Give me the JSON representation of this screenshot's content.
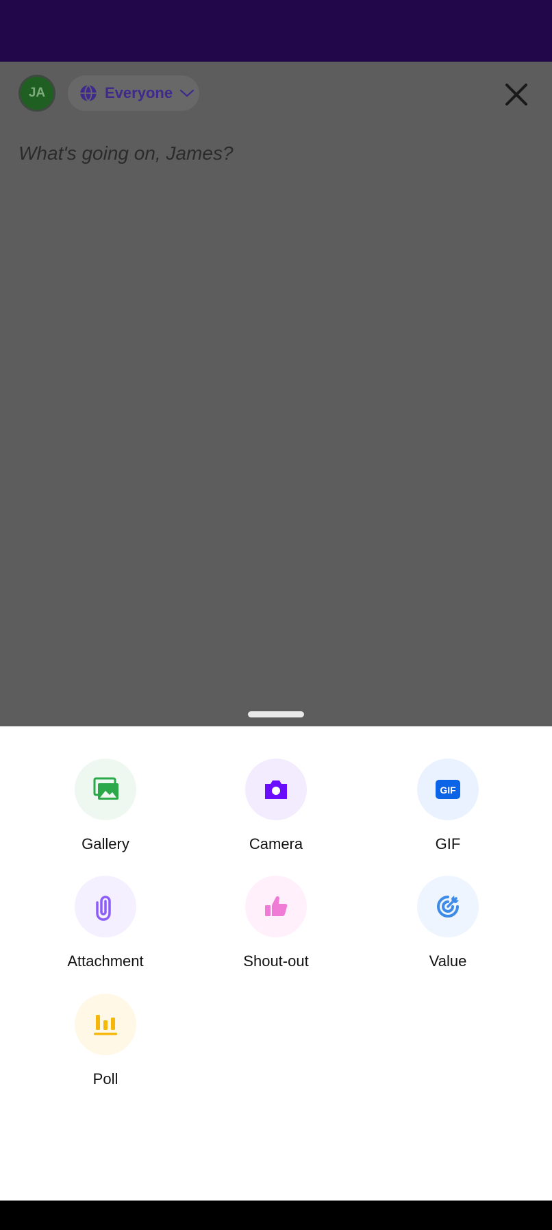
{
  "header": {
    "avatar_initials": "JA",
    "audience_label": "Everyone"
  },
  "composer": {
    "placeholder": "What's going on, James?"
  },
  "sheet": {
    "options": [
      {
        "label": "Gallery",
        "icon": "gallery-icon",
        "color": "#2aa84a",
        "bg": "#eef8f0"
      },
      {
        "label": "Camera",
        "icon": "camera-icon",
        "color": "#6a0dff",
        "bg": "#f3ecff"
      },
      {
        "label": "GIF",
        "icon": "gif-icon",
        "color": "#0b63e6",
        "bg": "#eaf2ff"
      },
      {
        "label": "Attachment",
        "icon": "paperclip-icon",
        "color": "#8b5cf6",
        "bg": "#f4f0ff"
      },
      {
        "label": "Shout-out",
        "icon": "thumbs-up-icon",
        "color": "#f07bd6",
        "bg": "#fff0fb"
      },
      {
        "label": "Value",
        "icon": "target-icon",
        "color": "#3d8be8",
        "bg": "#eef5ff"
      },
      {
        "label": "Poll",
        "icon": "poll-icon",
        "color": "#f5b80a",
        "bg": "#fff8e6"
      }
    ]
  }
}
